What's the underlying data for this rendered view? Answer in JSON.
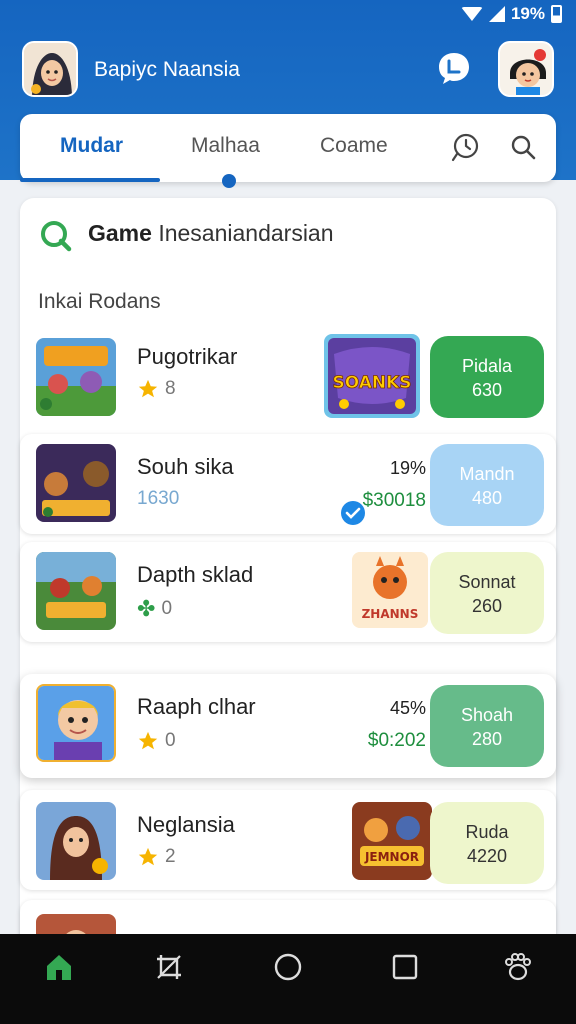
{
  "status": {
    "battery": "19%"
  },
  "header": {
    "title": "Bapiyc Naansia"
  },
  "tabs": [
    "Mudar",
    "Malhaa",
    "Coame"
  ],
  "section": {
    "title_bold": "Game",
    "title_rest": "Inesaniandarsian",
    "subhead": "Inkai Rodans"
  },
  "rows": [
    {
      "title": "Pugotrikar",
      "meta": "8",
      "promo_text": "SOANKS",
      "action": [
        "Pidala",
        "630"
      ],
      "action_bg": "#34a853",
      "action_fg": "#ffffff"
    },
    {
      "title": "Souh sika",
      "meta": "1630",
      "pct": "19%",
      "price": "$30018",
      "action": [
        "Mandn",
        "480"
      ],
      "action_bg": "#a8d4f5",
      "action_fg": "#ffffff"
    },
    {
      "title": "Dapth sklad",
      "meta": "0",
      "promo_text": "ZHANNS",
      "action": [
        "Sonnat",
        "260"
      ],
      "action_bg": "#eef6cc",
      "action_fg": "#333333"
    },
    {
      "title": "Raaph clhar",
      "meta": "0",
      "pct": "45%",
      "price": "$0:202",
      "action": [
        "Shoah",
        "280"
      ],
      "action_bg": "#66bb8a",
      "action_fg": "#ffffff"
    },
    {
      "title": "Neglansia",
      "meta": "2",
      "promo_text": "JEMNOR",
      "action": [
        "Ruda",
        "4220"
      ],
      "action_bg": "#eef6cc",
      "action_fg": "#333333"
    }
  ],
  "nav": [
    "home-icon",
    "crop-icon",
    "circle-icon",
    "square-icon",
    "paw-icon"
  ],
  "colors": {
    "primary": "#1565c0",
    "green": "#34a853",
    "price_green": "#1e8e3e"
  }
}
